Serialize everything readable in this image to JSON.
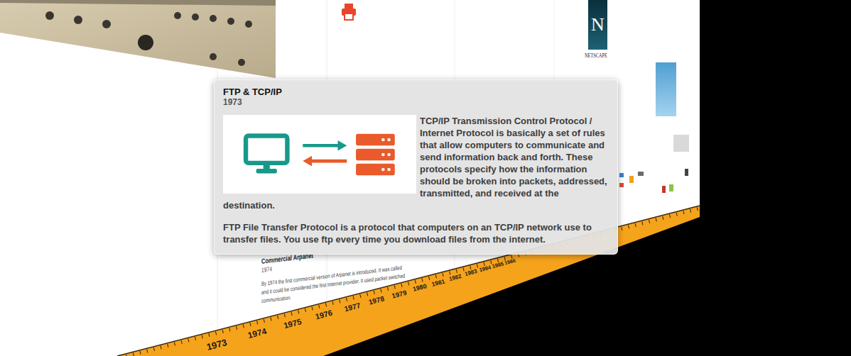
{
  "tooltip": {
    "title": "FTP & TCP/IP",
    "year": "1973",
    "paragraphs": [
      "TCP/IP Transmission Control Protocol / Internet Protocol is basically a set of rules that allow computers to communicate and send information back and forth. These protocols specify how the information should be broken into packets, addressed, transmitted, and received at the destination.",
      "FTP File Transfer Protocol is a protocol that computers on an TCP/IP network use to transfer files. You use ftp every time you download files from the internet."
    ]
  },
  "events": [
    {
      "title": "Commercial Arpanet",
      "year": "1974",
      "lines": [
        "By 1974 the first commercial version of Arpanet is introduced. It was called",
        "and it could be considered the first Internet provider. It used packet switched",
        "communication."
      ]
    }
  ],
  "logos": {
    "netscape": {
      "letter": "N",
      "wordmark": "NETSCAPE"
    }
  },
  "timeline": {
    "years": [
      "1973",
      "1974",
      "1975",
      "1976",
      "1977",
      "1978",
      "1979",
      "1980",
      "1981",
      "1982",
      "1983",
      "1984",
      "1985",
      "1986"
    ]
  }
}
